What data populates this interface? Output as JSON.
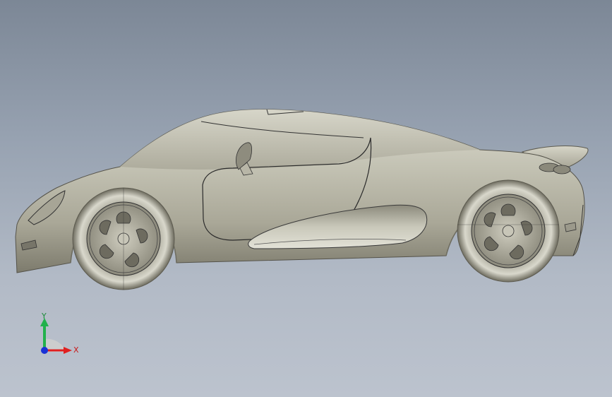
{
  "viewport": {
    "background_top": "#7c8796",
    "background_bottom": "#bcc3ce"
  },
  "model": {
    "name": "sports-car-side-view",
    "body_color": "#b9b7a8",
    "edge_color": "#2a2a2a"
  },
  "triad": {
    "y_label": "Y",
    "x_label": "X",
    "y_color": "#22b14c",
    "x_color": "#e02020",
    "z_color": "#1a32d6"
  }
}
